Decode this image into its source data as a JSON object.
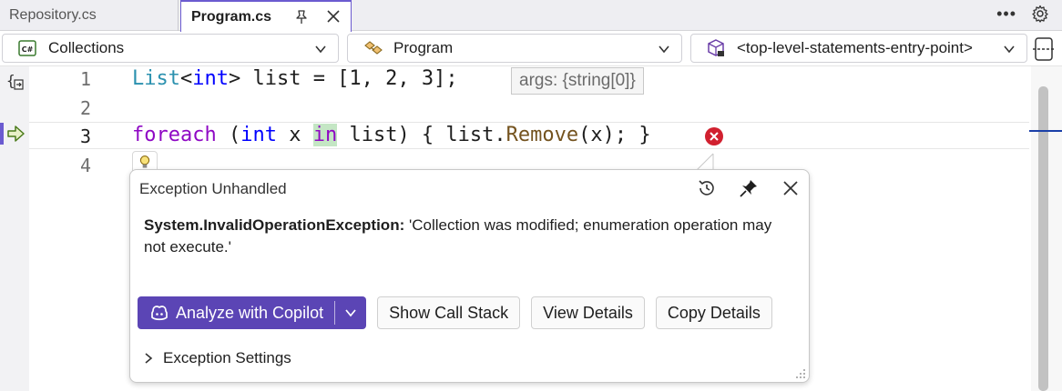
{
  "tabs": [
    {
      "label": "Repository.cs",
      "active": false
    },
    {
      "label": "Program.cs",
      "active": true
    }
  ],
  "navbar": {
    "project": "Collections",
    "type": "Program",
    "member": "<top-level-statements-entry-point>"
  },
  "editor": {
    "line_numbers": [
      "1",
      "2",
      "3",
      "4"
    ],
    "line1": {
      "type": "List",
      "lt": "<",
      "int": "int",
      "rest": "> list = [1, 2, 3];"
    },
    "line3": {
      "foreach": "foreach",
      "open": " (",
      "int": "int",
      "x": " x ",
      "in": "in",
      "rest1": " list) { list.",
      "method": "Remove",
      "rest2": "(x); }"
    },
    "datatip": "args: {string[0]}"
  },
  "exception": {
    "title": "Exception Unhandled",
    "exception_type": "System.InvalidOperationException:",
    "message": " 'Collection was modified; enumeration operation may not execute.'",
    "buttons": {
      "analyze": "Analyze with Copilot",
      "call_stack": "Show Call Stack",
      "view_details": "View Details",
      "copy_details": "Copy Details"
    },
    "settings": "Exception Settings"
  },
  "colors": {
    "accent": "#5b45b5",
    "error": "#d1202f",
    "tab_border": "#6b5bd0"
  }
}
